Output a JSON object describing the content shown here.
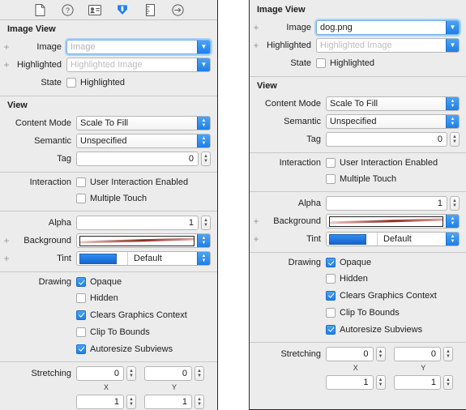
{
  "toolbar": {
    "icons": [
      {
        "name": "file-inspector-icon",
        "title": "File Inspector"
      },
      {
        "name": "quick-help-inspector-icon",
        "title": "Quick Help Inspector"
      },
      {
        "name": "identity-inspector-icon",
        "title": "Identity Inspector"
      },
      {
        "name": "attributes-inspector-icon",
        "title": "Attributes Inspector"
      },
      {
        "name": "size-inspector-icon",
        "title": "Size Inspector"
      },
      {
        "name": "connections-inspector-icon",
        "title": "Connections Inspector"
      }
    ],
    "selected_index": 3
  },
  "colors": {
    "accent": "#1f7fe8",
    "panel_bg": "#ececec",
    "field_bg": "#ffffff",
    "tint_swatch": "#2f8ef0",
    "background_swatch_stripe": "#8e2a20"
  },
  "panels": [
    {
      "id": "left",
      "has_toolbar": true,
      "image_view": {
        "title": "Image View",
        "image_label": "Image",
        "image_value": "",
        "image_placeholder": "Image",
        "image_focused": true,
        "highlighted_label": "Highlighted",
        "highlighted_value": "",
        "highlighted_placeholder": "Highlighted Image",
        "state_label": "State",
        "state_checkbox_label": "Highlighted",
        "state_checked": false
      },
      "view": {
        "title": "View",
        "content_mode_label": "Content Mode",
        "content_mode_value": "Scale To Fill",
        "semantic_label": "Semantic",
        "semantic_value": "Unspecified",
        "tag_label": "Tag",
        "tag_value": "0",
        "interaction_label": "Interaction",
        "user_interaction_label": "User Interaction Enabled",
        "user_interaction_checked": false,
        "multiple_touch_label": "Multiple Touch",
        "multiple_touch_checked": false,
        "alpha_label": "Alpha",
        "alpha_value": "1",
        "background_label": "Background",
        "background_value": "",
        "tint_label": "Tint",
        "tint_value": "Default",
        "drawing_label": "Drawing",
        "drawing_options": [
          {
            "label": "Opaque",
            "checked": true
          },
          {
            "label": "Hidden",
            "checked": false
          },
          {
            "label": "Clears Graphics Context",
            "checked": true
          },
          {
            "label": "Clip To Bounds",
            "checked": false
          },
          {
            "label": "Autoresize Subviews",
            "checked": true
          }
        ],
        "stretching_label": "Stretching",
        "stretching_x_value": "0",
        "stretching_y_value": "0",
        "stretching_x_axis": "X",
        "stretching_y_axis": "Y",
        "stretching_w_value": "1",
        "stretching_h_value": "1"
      }
    },
    {
      "id": "right",
      "has_toolbar": false,
      "image_view": {
        "title": "Image View",
        "image_label": "Image",
        "image_value": "dog.png",
        "image_placeholder": "Image",
        "image_focused": true,
        "highlighted_label": "Highlighted",
        "highlighted_value": "",
        "highlighted_placeholder": "Highlighted Image",
        "state_label": "State",
        "state_checkbox_label": "Highlighted",
        "state_checked": false
      },
      "view": {
        "title": "View",
        "content_mode_label": "Content Mode",
        "content_mode_value": "Scale To Fill",
        "semantic_label": "Semantic",
        "semantic_value": "Unspecified",
        "tag_label": "Tag",
        "tag_value": "0",
        "interaction_label": "Interaction",
        "user_interaction_label": "User Interaction Enabled",
        "user_interaction_checked": false,
        "multiple_touch_label": "Multiple Touch",
        "multiple_touch_checked": false,
        "alpha_label": "Alpha",
        "alpha_value": "1",
        "background_label": "Background",
        "background_value": "",
        "tint_label": "Tint",
        "tint_value": "Default",
        "drawing_label": "Drawing",
        "drawing_options": [
          {
            "label": "Opaque",
            "checked": true
          },
          {
            "label": "Hidden",
            "checked": false
          },
          {
            "label": "Clears Graphics Context",
            "checked": true
          },
          {
            "label": "Clip To Bounds",
            "checked": false
          },
          {
            "label": "Autoresize Subviews",
            "checked": true
          }
        ],
        "stretching_label": "Stretching",
        "stretching_x_value": "0",
        "stretching_y_value": "0",
        "stretching_x_axis": "X",
        "stretching_y_axis": "Y",
        "stretching_w_value": "1",
        "stretching_h_value": "1"
      }
    }
  ]
}
